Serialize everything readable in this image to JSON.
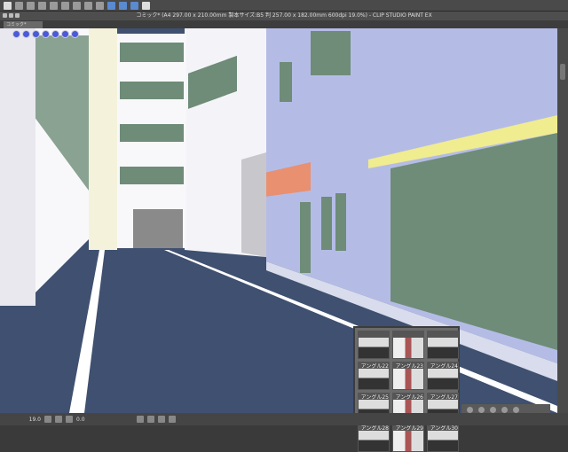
{
  "window": {
    "title": "コミック* (A4 297.00 x 210.00mm 製本サイズ:B5 判 257.00 x 182.00mm 600dpi 19.0%)  - CLIP STUDIO PAINT EX"
  },
  "tab": {
    "label": "コミック*"
  },
  "angle_panel": {
    "items": [
      {
        "label": ""
      },
      {
        "label": ""
      },
      {
        "label": ""
      },
      {
        "label": "アングル22"
      },
      {
        "label": "アングル23"
      },
      {
        "label": "アングル24"
      },
      {
        "label": "アングル25"
      },
      {
        "label": "アングル26"
      },
      {
        "label": "アングル27"
      },
      {
        "label": "アングル28"
      },
      {
        "label": "アングル29"
      },
      {
        "label": "アングル30"
      }
    ]
  },
  "status": {
    "zoom": "19.0",
    "angle": "0.0"
  },
  "colors": {
    "road": "#3f5070",
    "building_lavender": "#b4bce6",
    "glass": "#6e8c78"
  }
}
